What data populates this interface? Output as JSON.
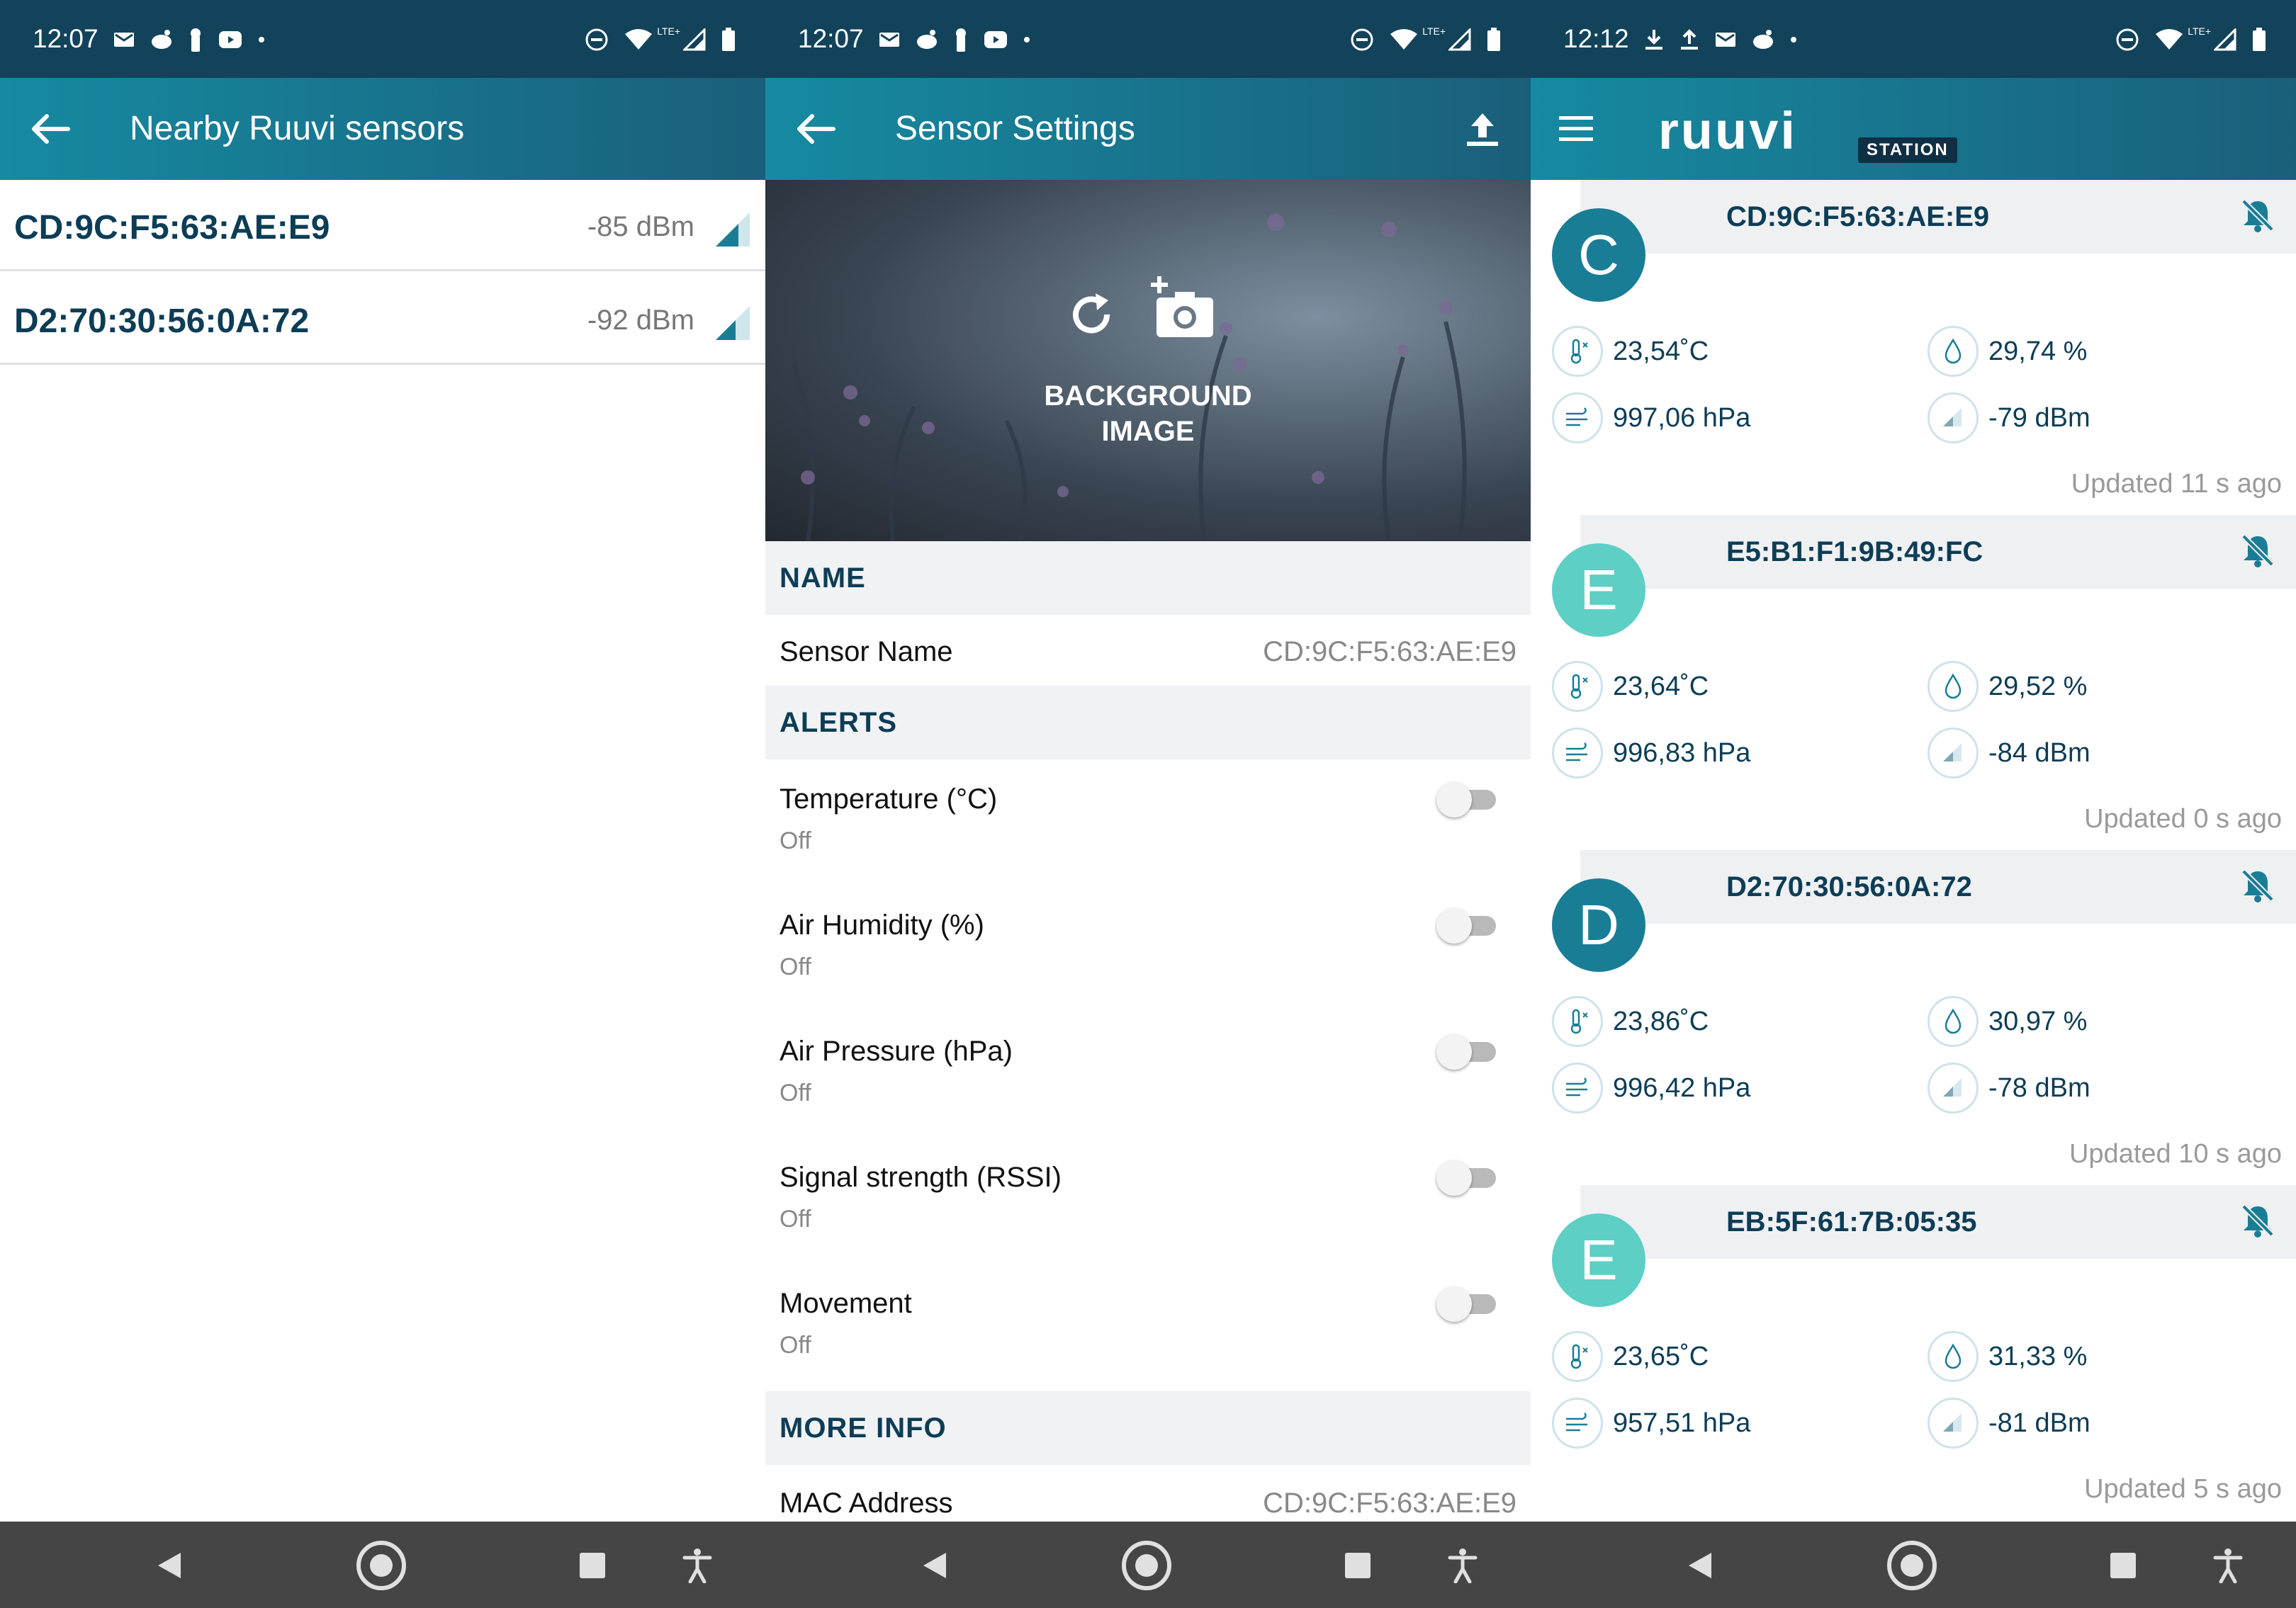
{
  "panel1": {
    "status": {
      "time": "12:07",
      "network": "LTE+"
    },
    "title": "Nearby Ruuvi sensors",
    "devices": [
      {
        "mac": "CD:9C:F5:63:AE:E9",
        "rssi": "-85 dBm"
      },
      {
        "mac": "D2:70:30:56:0A:72",
        "rssi": "-92 dBm"
      }
    ]
  },
  "panel2": {
    "status": {
      "time": "12:07",
      "network": "LTE+"
    },
    "title": "Sensor Settings",
    "background": {
      "label_line1": "BACKGROUND",
      "label_line2": "IMAGE"
    },
    "sections": {
      "name": "NAME",
      "alerts": "ALERTS",
      "more_info": "MORE INFO"
    },
    "sensor_name": {
      "label": "Sensor Name",
      "value": "CD:9C:F5:63:AE:E9"
    },
    "alerts": [
      {
        "label": "Temperature (°C)",
        "state": "Off",
        "enabled": false
      },
      {
        "label": "Air Humidity (%)",
        "state": "Off",
        "enabled": false
      },
      {
        "label": "Air Pressure (hPa)",
        "state": "Off",
        "enabled": false
      },
      {
        "label": "Signal strength (RSSI)",
        "state": "Off",
        "enabled": false
      },
      {
        "label": "Movement",
        "state": "Off",
        "enabled": false
      }
    ],
    "mac_address": {
      "label": "MAC Address",
      "value": "CD:9C:F5:63:AE:E9"
    }
  },
  "panel3": {
    "status": {
      "time": "12:12",
      "network": "LTE+"
    },
    "logo": {
      "word": "ruuvi",
      "badge": "STATION"
    },
    "sensors": [
      {
        "letter": "C",
        "name": "CD:9C:F5:63:AE:E9",
        "temperature": "23,54˚C",
        "humidity": "29,74 %",
        "pressure": "997,06 hPa",
        "rssi": "-79 dBm",
        "updated": "Updated 11 s ago",
        "avatar_color": "#1a7d96"
      },
      {
        "letter": "E",
        "name": "E5:B1:F1:9B:49:FC",
        "temperature": "23,64˚C",
        "humidity": "29,52 %",
        "pressure": "996,83 hPa",
        "rssi": "-84 dBm",
        "updated": "Updated 0 s ago",
        "avatar_color": "#5dcfc4"
      },
      {
        "letter": "D",
        "name": "D2:70:30:56:0A:72",
        "temperature": "23,86˚C",
        "humidity": "30,97 %",
        "pressure": "996,42 hPa",
        "rssi": "-78 dBm",
        "updated": "Updated 10 s ago",
        "avatar_color": "#1a7d96"
      },
      {
        "letter": "E",
        "name": "EB:5F:61:7B:05:35",
        "temperature": "23,65˚C",
        "humidity": "31,33 %",
        "pressure": "957,51 hPa",
        "rssi": "-81 dBm",
        "updated": "Updated 5 s ago",
        "avatar_color": "#5dcfc4"
      }
    ]
  },
  "colors": {
    "status_bar": "#12435a",
    "app_bar_start": "#168aa1",
    "app_bar_end": "#1a5f7a",
    "heading_text": "#0d3d56",
    "nav_bar": "#454545",
    "bell": "#1a7d96"
  }
}
